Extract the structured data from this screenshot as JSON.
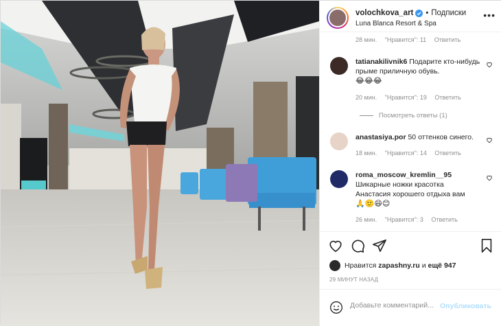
{
  "post": {
    "username": "volochkova_art",
    "follow_label": "Подписки",
    "location": "Luna Blanca Resort & Spa"
  },
  "comments": [
    {
      "time": "28 мин.",
      "likes": "\"Нравится\": 11",
      "reply": "Ответить"
    },
    {
      "username": "tatianakilivnik6",
      "text": "Подарите кто-нибудь прыме приличную обувь.",
      "emoji": "😂😂😂",
      "time": "20 мин.",
      "likes": "\"Нравится\": 19",
      "reply": "Ответить"
    },
    {
      "username": "anastasiya.por",
      "text": "50 оттенков синего.",
      "time": "18 мин.",
      "likes": "\"Нравится\": 14",
      "reply": "Ответить"
    },
    {
      "username": "roma_moscow_kremlin__95",
      "text": "Шикарные ножки красотка Анастасия хорошего отдыха вам",
      "emoji": "🙏🙂😄😊",
      "time": "26 мин.",
      "likes": "\"Нравится\": 3",
      "reply": "Ответить"
    }
  ],
  "view_replies": "Посмотреть ответы (1)",
  "likes_line": {
    "prefix": "Нравится",
    "user": "zapashny.ru",
    "middle": "и",
    "rest": "ещё 947"
  },
  "time_ago": "29 МИНУТ НАЗАД",
  "comment_box": {
    "placeholder": "Добавьте комментарий...",
    "publish": "Опубликовать"
  },
  "colors": {
    "verified": "#3897f0",
    "publish_disabled": "#b2dffc",
    "meta": "#8e8e8e"
  }
}
